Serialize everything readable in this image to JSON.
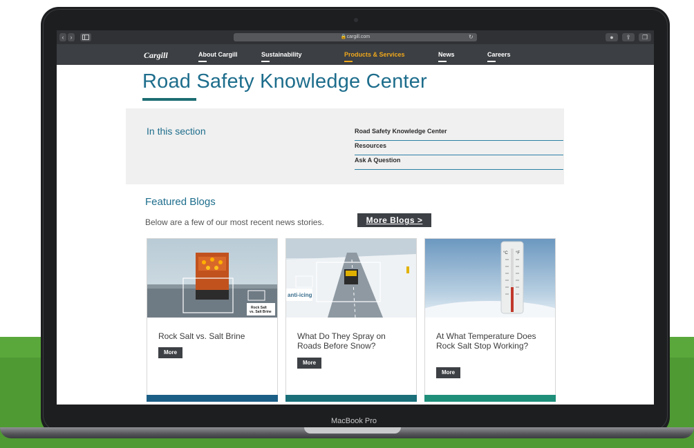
{
  "device": {
    "label": "MacBook Pro"
  },
  "browser": {
    "url": "cargill.com",
    "back": "‹",
    "forward": "›"
  },
  "nav": {
    "logo": "Cargill",
    "items": [
      {
        "label": "About Cargill"
      },
      {
        "label": "Sustainability"
      },
      {
        "label": "Products & Services"
      },
      {
        "label": "News"
      },
      {
        "label": "Careers"
      }
    ],
    "active_color": "#f0a81c"
  },
  "page": {
    "title": "Road Safety Knowledge Center"
  },
  "section": {
    "heading": "In this section",
    "links": [
      {
        "label": "Road Safety Knowledge Center"
      },
      {
        "label": "Resources"
      },
      {
        "label": "Ask A Question"
      }
    ]
  },
  "featured": {
    "heading": "Featured Blogs",
    "intro": "Below are a few of our most recent news stories.",
    "more_blogs_label": "More Blogs >"
  },
  "cards": [
    {
      "title": "Rock Salt vs. Salt Brine",
      "more_label": "More",
      "image_label_1": "Rock Salt",
      "image_label_2": "vs. Salt Brine",
      "strip_color": "#1c5f86"
    },
    {
      "title": "What Do They Spray on Roads Before Snow?",
      "more_label": "More",
      "image_label": "anti-icing",
      "strip_color": "#1a6f79"
    },
    {
      "title": "At What Temperature Does Rock Salt Stop Working?",
      "more_label": "More",
      "image_label_c": "°C",
      "image_label_f": "°F",
      "strip_color": "#1f8f7a"
    }
  ]
}
